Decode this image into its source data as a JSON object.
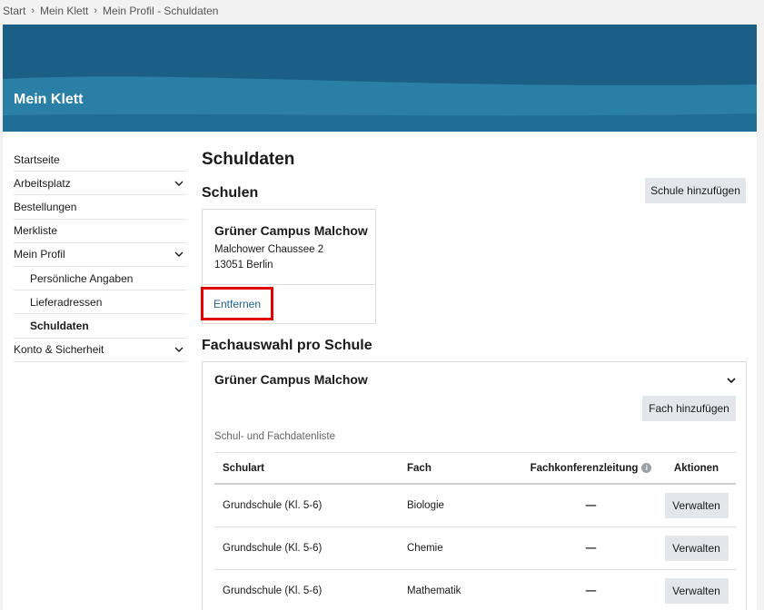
{
  "breadcrumb": [
    "Start",
    "Mein Klett",
    "Mein Profil - Schuldaten"
  ],
  "header": {
    "title": "Mein Klett"
  },
  "sidebar": {
    "items": [
      {
        "label": "Startseite",
        "expandable": false,
        "sub": false,
        "active": false
      },
      {
        "label": "Arbeitsplatz",
        "expandable": true,
        "sub": false,
        "active": false
      },
      {
        "label": "Bestellungen",
        "expandable": false,
        "sub": false,
        "active": false
      },
      {
        "label": "Merkliste",
        "expandable": false,
        "sub": false,
        "active": false
      },
      {
        "label": "Mein Profil",
        "expandable": true,
        "sub": false,
        "active": false
      },
      {
        "label": "Persönliche Angaben",
        "expandable": false,
        "sub": true,
        "active": false
      },
      {
        "label": "Lieferadressen",
        "expandable": false,
        "sub": true,
        "active": false
      },
      {
        "label": "Schuldaten",
        "expandable": false,
        "sub": true,
        "active": true
      },
      {
        "label": "Konto & Sicherheit",
        "expandable": true,
        "sub": false,
        "active": false
      }
    ]
  },
  "main": {
    "title": "Schuldaten",
    "schools_heading": "Schulen",
    "add_school_label": "Schule hinzufügen",
    "school_card": {
      "name": "Grüner Campus Malchow",
      "street": "Malchower Chaussee 2",
      "city": "13051 Berlin",
      "remove_label": "Entfernen"
    },
    "subjects_heading": "Fachauswahl pro Schule",
    "accordion": {
      "title": "Grüner Campus Malchow",
      "add_subject_label": "Fach hinzufügen",
      "list_caption": "Schul- und Fachdatenliste",
      "columns": [
        "Schulart",
        "Fach",
        "Fachkonferenzleitung",
        "Aktionen"
      ],
      "rows": [
        {
          "schulart": "Grundschule (Kl. 5-6)",
          "fach": "Biologie",
          "leitung": "—",
          "action": "Verwalten"
        },
        {
          "schulart": "Grundschule (Kl. 5-6)",
          "fach": "Chemie",
          "leitung": "—",
          "action": "Verwalten"
        },
        {
          "schulart": "Grundschule (Kl. 5-6)",
          "fach": "Mathematik",
          "leitung": "—",
          "action": "Verwalten"
        }
      ]
    }
  },
  "colors": {
    "brand_dark": "#1b5f86",
    "brand_light": "#2a7fa6",
    "link": "#1f5f8c",
    "highlight": "#e10000"
  }
}
